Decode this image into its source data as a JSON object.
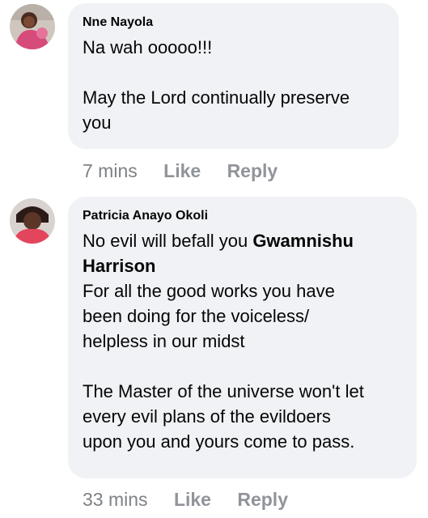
{
  "comments": [
    {
      "author": "Nne Nayola",
      "lines": [
        "Na wah ooooo!!!",
        "",
        "May the Lord continually preserve",
        "you"
      ],
      "time": "7 mins",
      "like_label": "Like",
      "reply_label": "Reply"
    },
    {
      "author": "Patricia Anayo Okoli",
      "line1_text": "No evil will befall you ",
      "mention": "Gwamnishu Harrison",
      "lines": [
        "For all the good works you have",
        "been doing for the voiceless/",
        "helpless in our midst",
        "",
        "The Master of the universe won't let",
        "every evil plans of the evildoers",
        "upon you and yours come to pass."
      ],
      "time": "33 mins",
      "like_label": "Like",
      "reply_label": "Reply"
    }
  ],
  "colors": {
    "bubble": "#f0f2f5",
    "meta_text": "#7e8185",
    "avatar1_bg": "#d64b7a",
    "avatar2_bg": "#e3455c"
  },
  "icons": {
    "avatar1": "user-photo-avatar",
    "avatar2": "user-photo-avatar"
  }
}
